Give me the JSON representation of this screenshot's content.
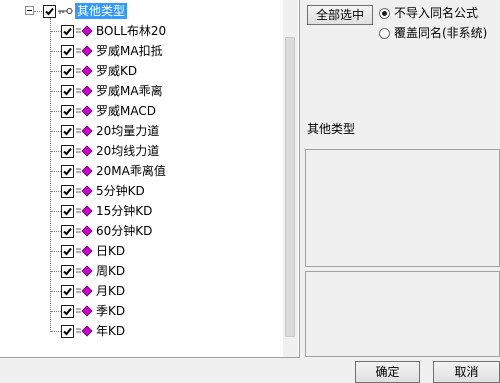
{
  "tree": {
    "root_label": "其他类型",
    "items": [
      {
        "label": "BOLL布林20"
      },
      {
        "label": "罗威MA扣抵"
      },
      {
        "label": "罗威KD"
      },
      {
        "label": "罗威MA乖离"
      },
      {
        "label": "罗威MACD"
      },
      {
        "label": "20均量力道"
      },
      {
        "label": "20均线力道"
      },
      {
        "label": "20MA乖离值"
      },
      {
        "label": "5分钟KD"
      },
      {
        "label": "15分钟KD"
      },
      {
        "label": "60分钟KD"
      },
      {
        "label": "日KD"
      },
      {
        "label": "周KD"
      },
      {
        "label": "月KD"
      },
      {
        "label": "季KD"
      },
      {
        "label": "年KD"
      }
    ]
  },
  "options": {
    "select_all_label": "全部选中",
    "no_import_label": "不导入同名公式",
    "overwrite_label": "覆盖同名(非系统)",
    "selected": "no_import"
  },
  "info": {
    "type_label": "其他类型"
  },
  "buttons": {
    "ok_label": "确定",
    "cancel_label": "取消"
  },
  "colors": {
    "selection": "#3399ff",
    "item_icon": "#cc00cc"
  }
}
